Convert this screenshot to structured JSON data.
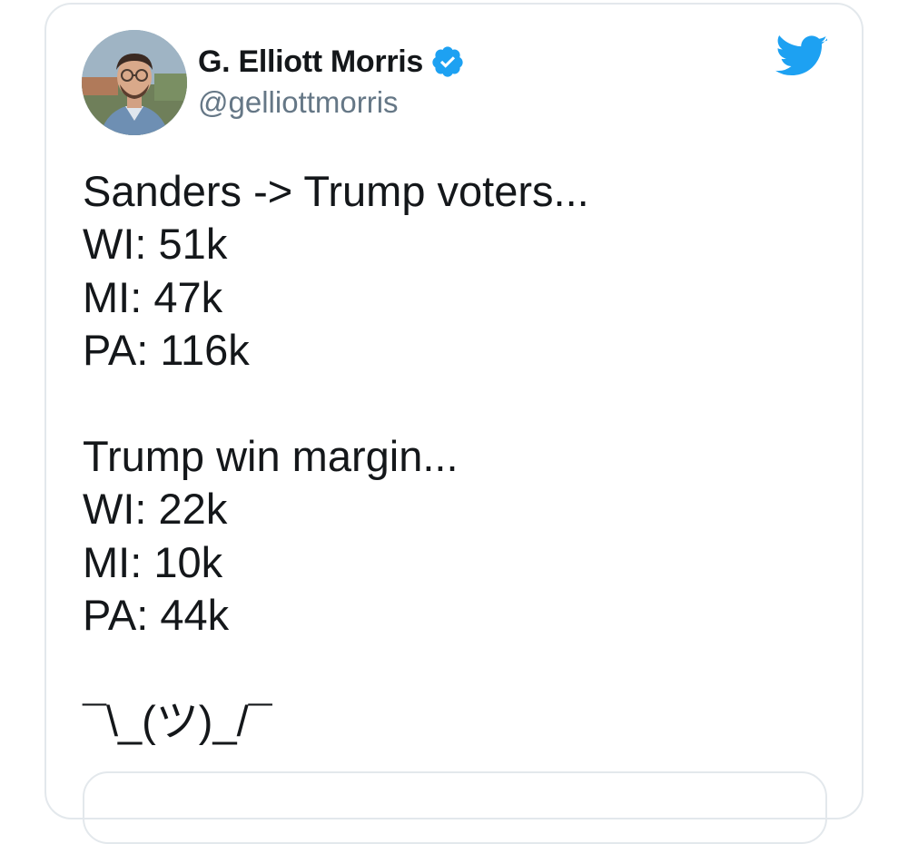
{
  "tweet": {
    "author": {
      "display_name": "G. Elliott Morris",
      "handle": "@gelliottmorris",
      "verified": true,
      "avatar_icon": "profile-photo"
    },
    "brand_icon": "twitter-bird-icon",
    "colors": {
      "brand_blue": "#1da1f2",
      "text": "#14171a",
      "secondary_text": "#657786",
      "border": "#e3e8ec"
    },
    "text_lines": {
      "l1": "Sanders -> Trump voters...",
      "l2": "WI: 51k",
      "l3": "MI: 47k",
      "l4": "PA: 116k",
      "l5": "Trump win margin...",
      "l6": "WI: 22k",
      "l7": "MI: 10k",
      "l8": "PA: 44k",
      "l9": "¯\\_(ツ)_/¯"
    }
  }
}
